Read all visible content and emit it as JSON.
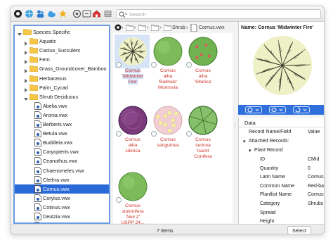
{
  "search": {
    "placeholder": "Search"
  },
  "tree": {
    "items": [
      {
        "label": "Species Specific",
        "kind": "folder",
        "level": 0,
        "expanded": true
      },
      {
        "label": "Aquatic",
        "kind": "folder",
        "level": 1
      },
      {
        "label": "Cactus_Succulent",
        "kind": "folder",
        "level": 1
      },
      {
        "label": "Fern",
        "kind": "folder",
        "level": 1
      },
      {
        "label": "Grass_Groundcover_Bamboo",
        "kind": "folder",
        "level": 1
      },
      {
        "label": "Herbaceous",
        "kind": "folder",
        "level": 1
      },
      {
        "label": "Palm_Cycad",
        "kind": "folder",
        "level": 1
      },
      {
        "label": "Shrub Deciduous",
        "kind": "folder",
        "level": 1,
        "expanded": true
      },
      {
        "label": "Abelia.vwx",
        "kind": "file",
        "level": 2
      },
      {
        "label": "Aronia.vwx",
        "kind": "file",
        "level": 2
      },
      {
        "label": "Berberis.vwx",
        "kind": "file",
        "level": 2
      },
      {
        "label": "Betula.vwx",
        "kind": "file",
        "level": 2
      },
      {
        "label": "Buddleia.vwx",
        "kind": "file",
        "level": 2
      },
      {
        "label": "Caryopteris.vwx",
        "kind": "file",
        "level": 2
      },
      {
        "label": "Ceanothus.vwx",
        "kind": "file",
        "level": 2
      },
      {
        "label": "Chaenomeles.vwx",
        "kind": "file",
        "level": 2
      },
      {
        "label": "Clethra.vwx",
        "kind": "file",
        "level": 2
      },
      {
        "label": "Cornus.vwx",
        "kind": "file",
        "level": 2,
        "selected": true
      },
      {
        "label": "Corylus.vwx",
        "kind": "file",
        "level": 2
      },
      {
        "label": "Cotinus.vwx",
        "kind": "file",
        "level": 2
      },
      {
        "label": "Deutzia.vwx",
        "kind": "file",
        "level": 2
      },
      {
        "label": "Euonymus.vwx",
        "kind": "file",
        "level": 2
      }
    ]
  },
  "path": {
    "crumbs": [
      "",
      "",
      "",
      "Shrub",
      "Cornus.vwx"
    ]
  },
  "thumbnails": [
    {
      "caption": [
        "Cornus",
        "'Midwinter",
        "Fire'"
      ],
      "style": "spiky",
      "selected": true
    },
    {
      "caption": [
        "Cornus",
        "alba",
        "'Bailhalo'",
        "Monrovia"
      ],
      "style": "green-round"
    },
    {
      "caption": [
        "Cornus",
        "alba",
        "'Sibirica'"
      ],
      "style": "green-dots"
    },
    {
      "caption": [
        "Cornus",
        "alba",
        "sibirica"
      ],
      "style": "purple"
    },
    {
      "caption": [
        "Cornus",
        "sanguinea"
      ],
      "style": "pink-flower"
    },
    {
      "caption": [
        "Cornus",
        "sericea",
        "'Isanti'",
        "Conifera"
      ],
      "style": "green-segmented"
    },
    {
      "caption": [
        "Cornus",
        "stolonifera",
        "'Neil Z'",
        "USPP 24..."
      ],
      "style": "green-round"
    }
  ],
  "preview": {
    "name": "Name: Cornus 'Midwinter Fire'"
  },
  "data_panel": {
    "tab": "Data",
    "header_key": "Record Name/Field",
    "header_value": "Value",
    "attached_records": "Attached Records:",
    "plant_record": "Plant Record",
    "fields": [
      {
        "k": "ID",
        "v": "CMid"
      },
      {
        "k": "Quantity",
        "v": "0"
      },
      {
        "k": "Latin Name",
        "v": "Cornus s"
      },
      {
        "k": "Common Name",
        "v": "Red-bark"
      },
      {
        "k": "Plantlist Name",
        "v": "Cornus s"
      },
      {
        "k": "Category",
        "v": "Shrubs"
      },
      {
        "k": "Spread",
        "v": ""
      },
      {
        "k": "Height",
        "v": ""
      }
    ]
  },
  "status": {
    "count": "7 Items",
    "select_label": "Select"
  },
  "colors": {
    "selection": "#2a6ad8",
    "caption": "#d0362c",
    "panel_border": "#6b9be0"
  }
}
